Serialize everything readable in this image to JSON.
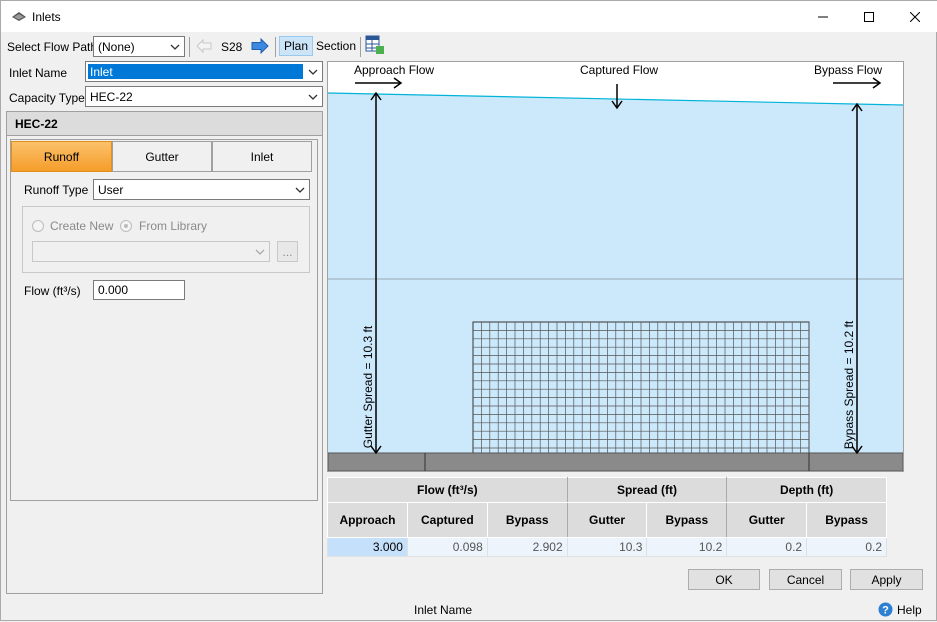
{
  "window": {
    "title": "Inlets"
  },
  "toolbar": {
    "flow_path_label": "Select Flow Path",
    "flow_path_value": "(None)",
    "current_node": "S28",
    "plan_label": "Plan",
    "section_label": "Section"
  },
  "form": {
    "inlet_name_label": "Inlet Name",
    "inlet_name_value": "Inlet",
    "capacity_type_label": "Capacity Type",
    "capacity_type_value": "HEC-22",
    "group_title": "HEC-22",
    "tabs": [
      "Runoff",
      "Gutter",
      "Inlet"
    ],
    "active_tab": "Runoff",
    "runoff_type_label": "Runoff Type",
    "runoff_type_value": "User",
    "create_new_label": "Create New",
    "from_library_label": "From Library",
    "browse_label": "...",
    "flow_label": "Flow (ft³/s)",
    "flow_value": "0.000"
  },
  "diagram": {
    "approach_label": "Approach Flow",
    "captured_label": "Captured Flow",
    "bypass_label": "Bypass Flow",
    "gutter_spread_label": "Gutter Spread = 10.3 ft",
    "bypass_spread_label": "Bypass Spread = 10.2 ft",
    "water_color": "#cce8fb",
    "line_color": "#00b4d8"
  },
  "results": {
    "groups": [
      "Flow (ft³/s)",
      "Spread (ft)",
      "Depth (ft)"
    ],
    "columns": [
      "Approach",
      "Captured",
      "Bypass",
      "Gutter",
      "Bypass",
      "Gutter",
      "Bypass"
    ],
    "values": [
      "3.000",
      "0.098",
      "2.902",
      "10.3",
      "10.2",
      "0.2",
      "0.2"
    ]
  },
  "buttons": {
    "ok": "OK",
    "cancel": "Cancel",
    "apply": "Apply"
  },
  "status": {
    "text": "Inlet Name",
    "help": "Help"
  }
}
